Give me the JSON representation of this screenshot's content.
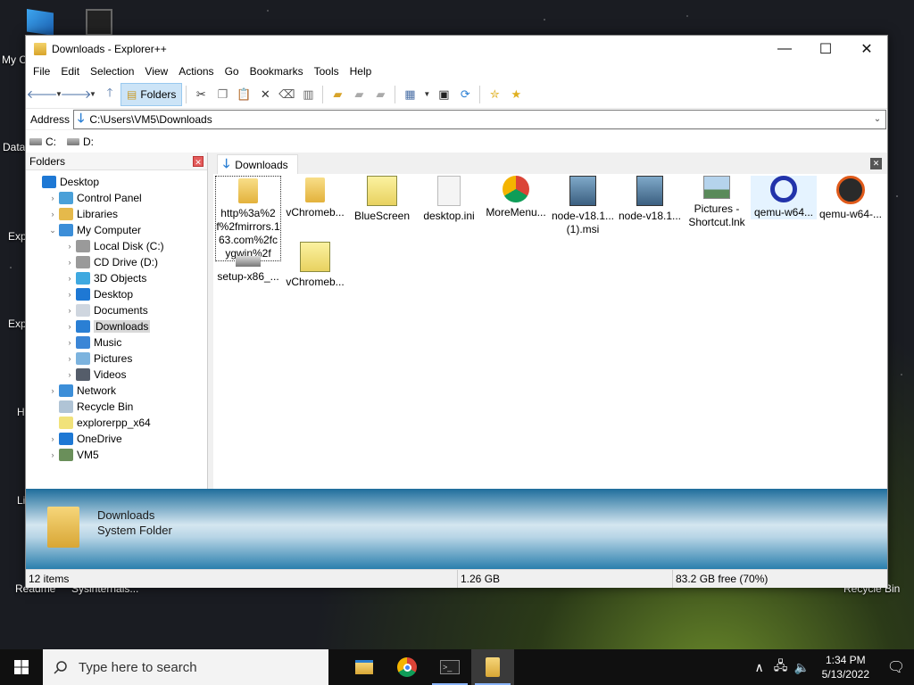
{
  "desktop": {
    "icons": [
      {
        "label": "My C",
        "id": "my-computer"
      },
      {
        "label": "Data",
        "id": "data"
      },
      {
        "label": "Exp",
        "id": "exp1"
      },
      {
        "label": "Exp",
        "id": "exp2"
      },
      {
        "label": "H",
        "id": "h"
      },
      {
        "label": "Li",
        "id": "li"
      },
      {
        "label": "Readme",
        "id": "readme"
      },
      {
        "label": "Sysinternals...",
        "id": "sysinternals"
      },
      {
        "label": "Recycle Bin",
        "id": "recycle-bin"
      }
    ]
  },
  "window": {
    "title": "Downloads - Explorer++",
    "controls": {
      "minimize": "—",
      "maximize": "☐",
      "close": "✕"
    }
  },
  "menu": [
    "File",
    "Edit",
    "Selection",
    "View",
    "Actions",
    "Go",
    "Bookmarks",
    "Tools",
    "Help"
  ],
  "toolbar": {
    "folders_label": "Folders"
  },
  "address": {
    "label": "Address",
    "value": "C:\\Users\\VM5\\Downloads"
  },
  "drives": [
    {
      "label": "C:"
    },
    {
      "label": "D:"
    }
  ],
  "folders_pane": {
    "title": "Folders",
    "tree": [
      {
        "label": "Desktop",
        "depth": 0,
        "expander": "",
        "icon": "desktop-icon",
        "color": "#1e78d4"
      },
      {
        "label": "Control Panel",
        "depth": 1,
        "expander": "›",
        "icon": "control-panel-icon",
        "color": "#4aa0d8"
      },
      {
        "label": "Libraries",
        "depth": 1,
        "expander": "›",
        "icon": "libraries-icon",
        "color": "#e5b94b"
      },
      {
        "label": "My Computer",
        "depth": 1,
        "expander": "⌄",
        "icon": "computer-icon",
        "color": "#3c8ed8"
      },
      {
        "label": "Local Disk (C:)",
        "depth": 2,
        "expander": "›",
        "icon": "local-disk-icon",
        "color": "#9a9a9a"
      },
      {
        "label": "CD Drive (D:)",
        "depth": 2,
        "expander": "›",
        "icon": "cd-drive-icon",
        "color": "#9a9a9a"
      },
      {
        "label": "3D Objects",
        "depth": 2,
        "expander": "›",
        "icon": "3d-objects-icon",
        "color": "#3fa9e0"
      },
      {
        "label": "Desktop",
        "depth": 2,
        "expander": "›",
        "icon": "desktop-icon",
        "color": "#1e78d4"
      },
      {
        "label": "Documents",
        "depth": 2,
        "expander": "›",
        "icon": "documents-icon",
        "color": "#cfd6df"
      },
      {
        "label": "Downloads",
        "depth": 2,
        "expander": "›",
        "icon": "downloads-icon",
        "color": "#2a7fd4",
        "selected": true
      },
      {
        "label": "Music",
        "depth": 2,
        "expander": "›",
        "icon": "music-icon",
        "color": "#3b86d6"
      },
      {
        "label": "Pictures",
        "depth": 2,
        "expander": "›",
        "icon": "pictures-icon",
        "color": "#7cb3de"
      },
      {
        "label": "Videos",
        "depth": 2,
        "expander": "›",
        "icon": "videos-icon",
        "color": "#555d6a"
      },
      {
        "label": "Network",
        "depth": 1,
        "expander": "›",
        "icon": "network-icon",
        "color": "#3c8ed8"
      },
      {
        "label": "Recycle Bin",
        "depth": 1,
        "expander": "",
        "icon": "recycle-bin-icon",
        "color": "#b0c4d6"
      },
      {
        "label": "explorerpp_x64",
        "depth": 1,
        "expander": "",
        "icon": "zip-folder-icon",
        "color": "#f1e27a"
      },
      {
        "label": "OneDrive",
        "depth": 1,
        "expander": "›",
        "icon": "onedrive-icon",
        "color": "#1e78d4"
      },
      {
        "label": "VM5",
        "depth": 1,
        "expander": "›",
        "icon": "user-icon",
        "color": "#6a8f5a"
      }
    ]
  },
  "tab": {
    "label": "Downloads"
  },
  "files": [
    {
      "name": "http%3a%2f%2fmirrors.163.com%2fcygwin%2f",
      "icon": "folder-icon",
      "kind": "folder",
      "focus": true
    },
    {
      "name": "vChromeb...",
      "icon": "folder-icon",
      "kind": "folder"
    },
    {
      "name": "BlueScreen",
      "icon": "zip-folder-icon",
      "kind": "zip"
    },
    {
      "name": "desktop.ini",
      "icon": "ini-file-icon",
      "kind": "ini"
    },
    {
      "name": "MoreMenu...",
      "icon": "chrome-icon",
      "kind": "chrome"
    },
    {
      "name": "node-v18.1... (1).msi",
      "icon": "msi-installer-icon",
      "kind": "msi"
    },
    {
      "name": "node-v18.1...",
      "icon": "msi-installer-icon",
      "kind": "msi"
    },
    {
      "name": "Pictures - Shortcut.lnk",
      "icon": "shortcut-icon",
      "kind": "lnk"
    },
    {
      "name": "qemu-w64...",
      "icon": "qemu-icon",
      "kind": "qemu",
      "selected": true
    },
    {
      "name": "qemu-w64-...",
      "icon": "qemu-alt-icon",
      "kind": "qemu2"
    },
    {
      "name": "setup-x86_...",
      "icon": "setup-drive-icon",
      "kind": "setup"
    },
    {
      "name": "vChromeb...",
      "icon": "zip-folder-icon",
      "kind": "zip"
    }
  ],
  "info_panel": {
    "name": "Downloads",
    "type": "System Folder"
  },
  "status": {
    "items": "12 items",
    "size": "1.26 GB",
    "free": "83.2 GB free (70%)"
  },
  "taskbar": {
    "search_placeholder": "Type here to search",
    "time": "1:34 PM",
    "date": "5/13/2022"
  }
}
